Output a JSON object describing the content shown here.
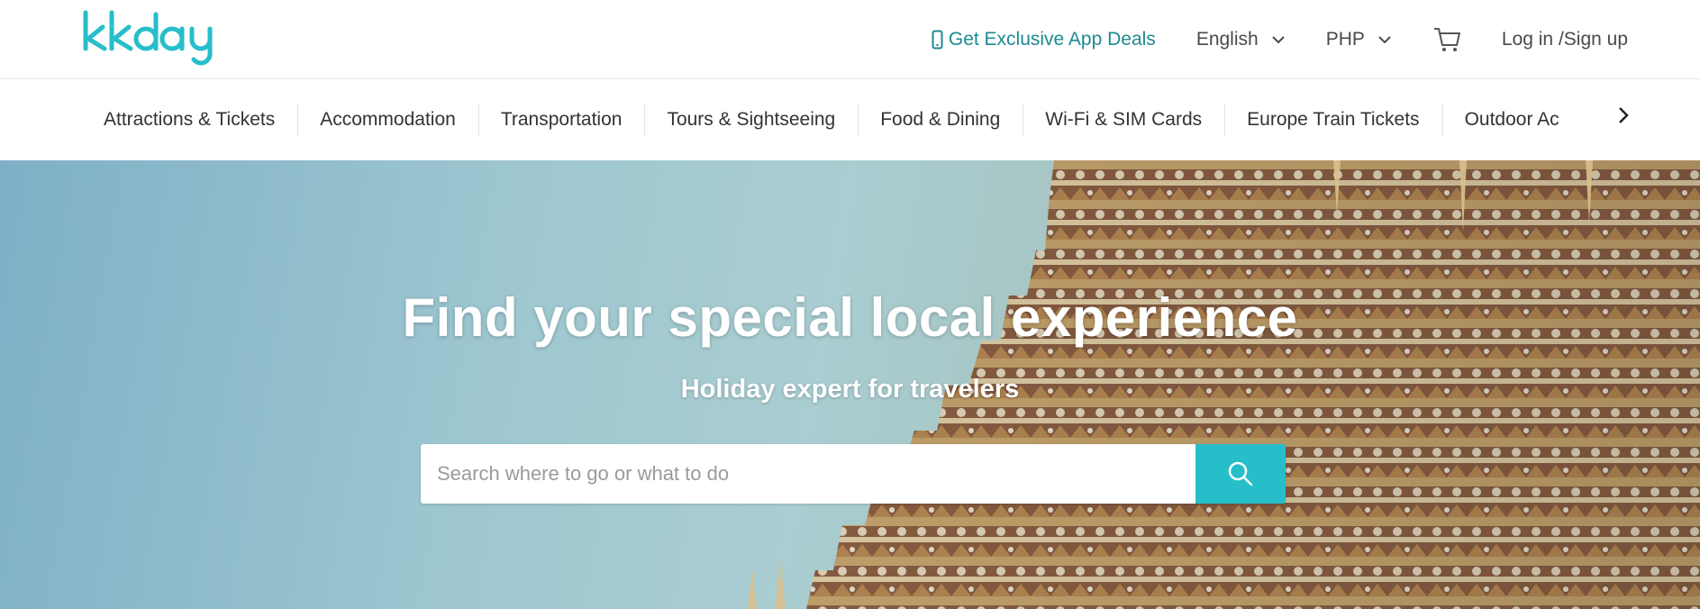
{
  "brand": {
    "logo_text": "kkday",
    "color": "#26bec9"
  },
  "header": {
    "app_deals_label": "Get Exclusive App Deals",
    "language_label": "English",
    "currency_label": "PHP",
    "login_label": "Log in /Sign up",
    "icons": [
      "phone-icon",
      "chevron-down-icon",
      "cart-icon"
    ]
  },
  "categories": [
    {
      "label": "Attractions & Tickets"
    },
    {
      "label": "Accommodation"
    },
    {
      "label": "Transportation"
    },
    {
      "label": "Tours & Sightseeing"
    },
    {
      "label": "Food & Dining"
    },
    {
      "label": "Wi-Fi & SIM Cards"
    },
    {
      "label": "Europe Train Tickets"
    },
    {
      "label": "Outdoor Ac"
    }
  ],
  "hero": {
    "title": "Find your special local experience",
    "subtitle": "Holiday expert for travelers",
    "search_placeholder": "Search where to go or what to do",
    "search_value": ""
  },
  "colors": {
    "accent": "#26bec9",
    "link": "#1d8a90",
    "text": "#333333"
  }
}
